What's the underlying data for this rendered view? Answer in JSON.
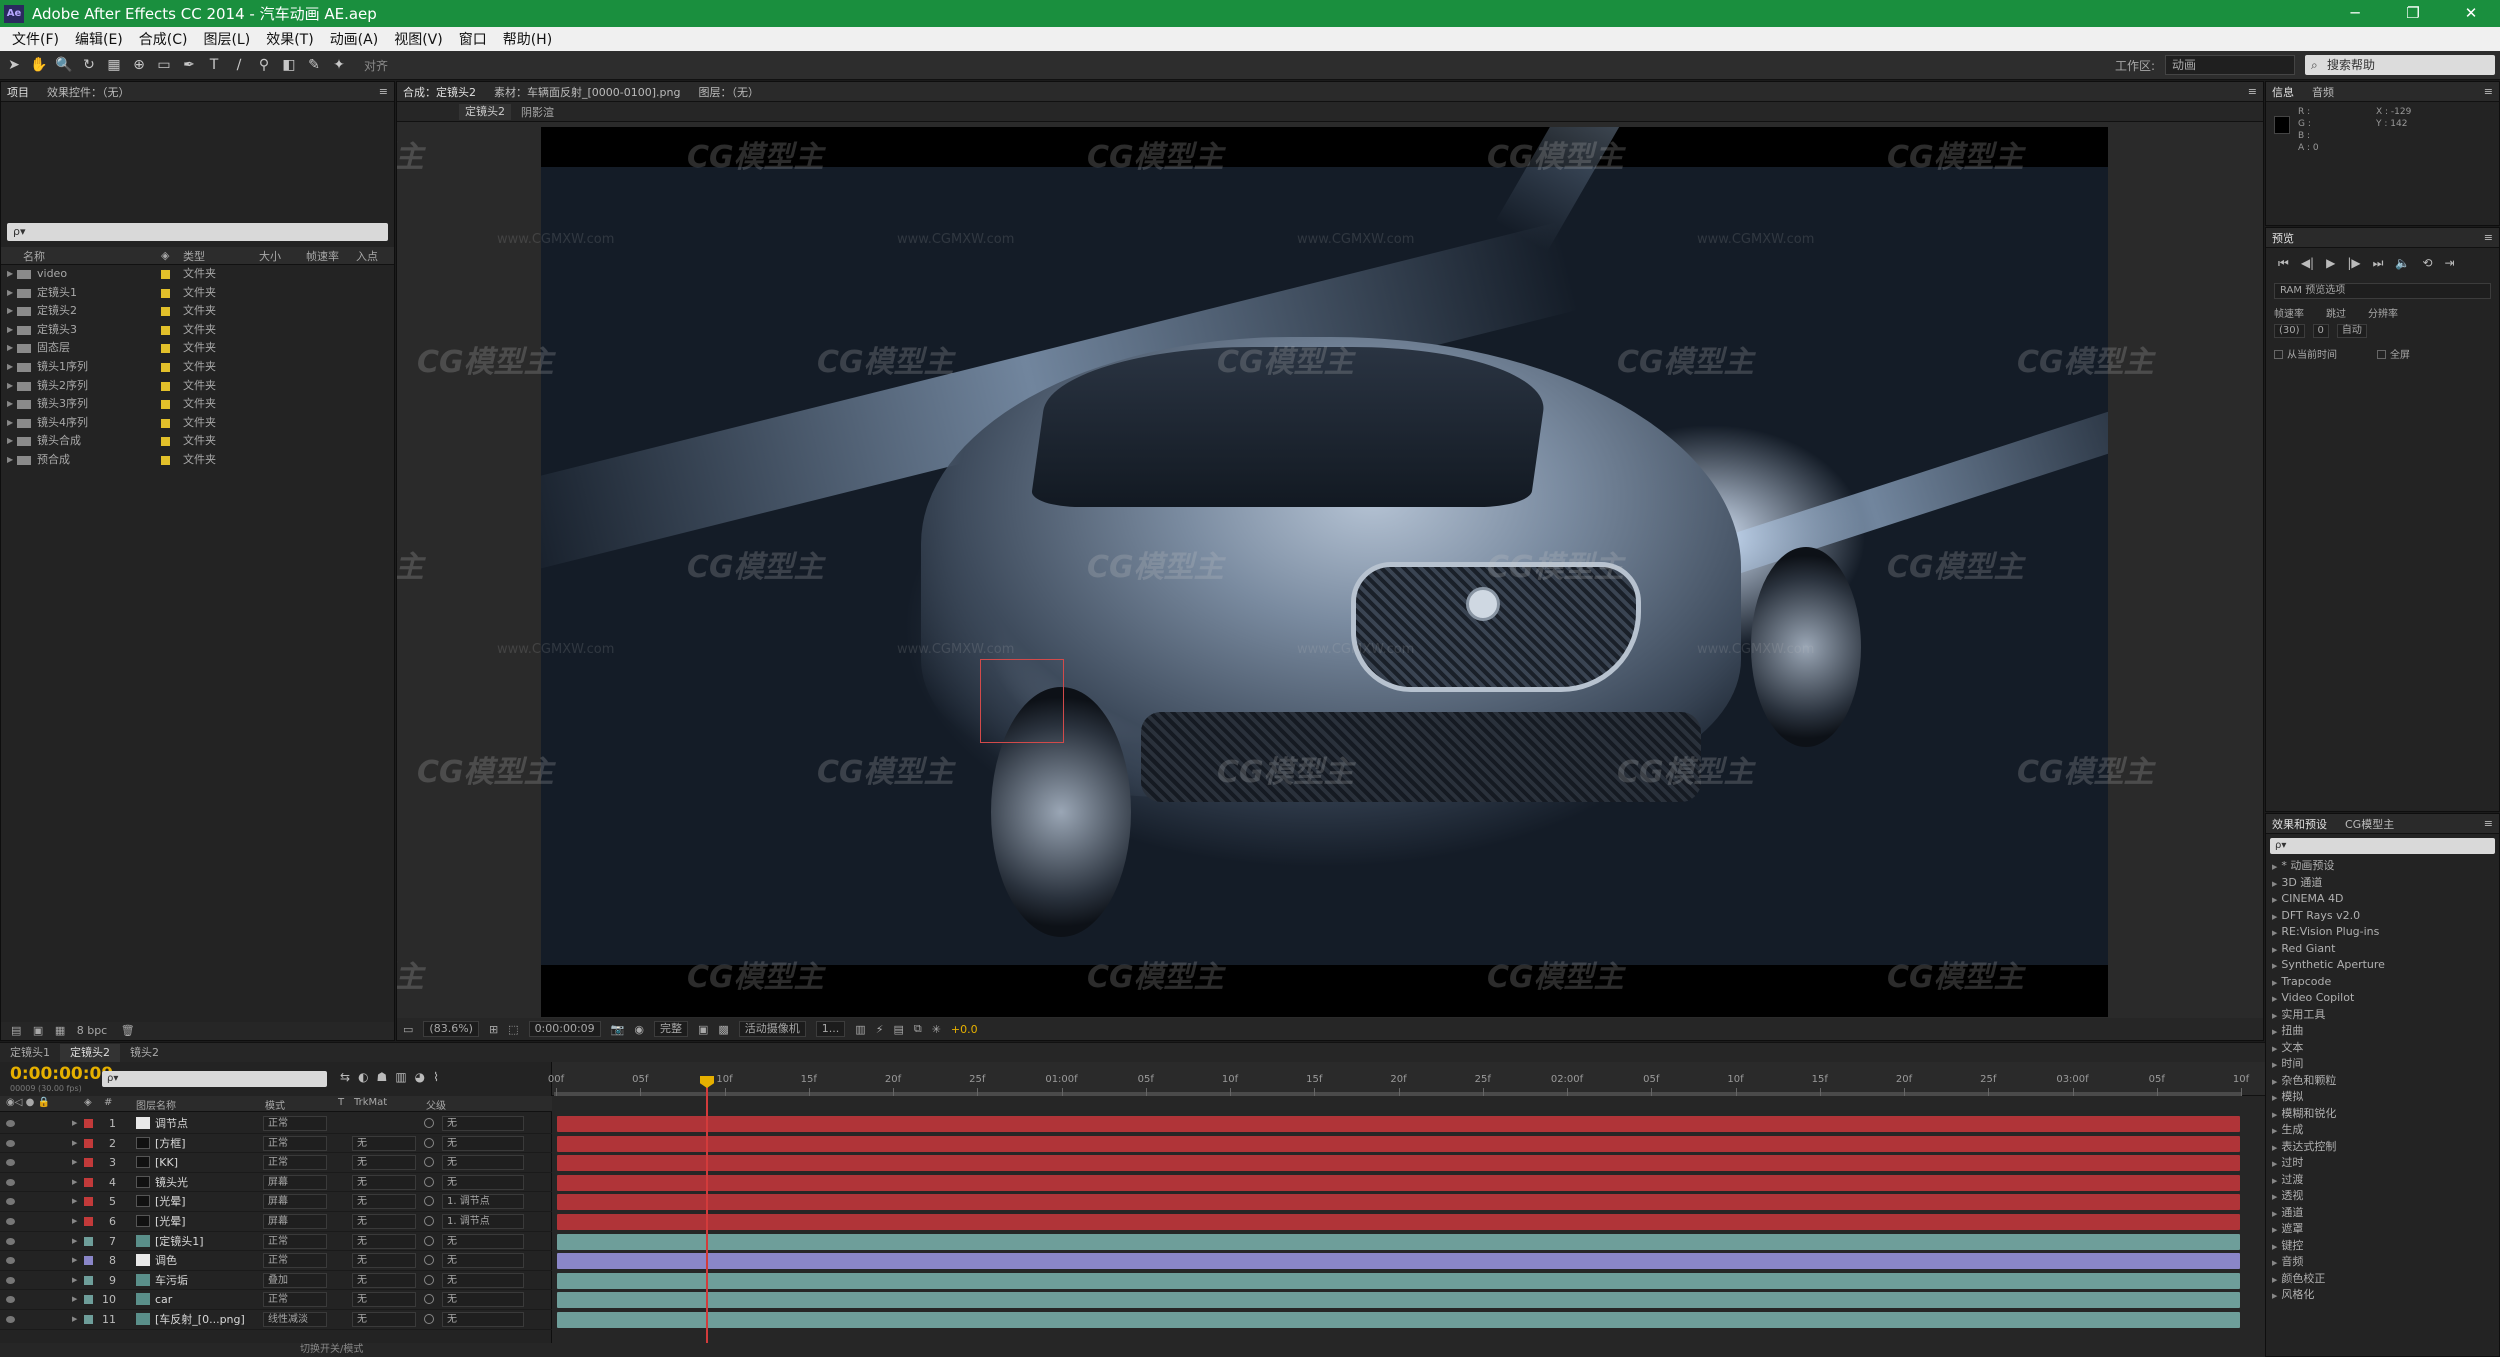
{
  "window": {
    "title": "Adobe After Effects CC 2014 - 汽车动画 AE.aep",
    "app_icon": "Ae",
    "controls": [
      "─",
      "❐",
      "✕"
    ]
  },
  "menu": [
    "文件(F)",
    "编辑(E)",
    "合成(C)",
    "图层(L)",
    "效果(T)",
    "动画(A)",
    "视图(V)",
    "窗口",
    "帮助(H)"
  ],
  "toolbar": {
    "snap_label": "对齐",
    "workspace_label": "工作区:",
    "workspace_value": "动画",
    "search_placeholder": "搜索帮助"
  },
  "project_panel": {
    "tabs": [
      "项目",
      "效果控件：（无）"
    ],
    "search_placeholder": "ρ▾",
    "columns": {
      "name": "名称",
      "type": "类型",
      "size": "大小",
      "fps": "帧速率",
      "in": "入点"
    },
    "items": [
      {
        "name": "video",
        "type": "文件夹"
      },
      {
        "name": "定镜头1",
        "type": "文件夹"
      },
      {
        "name": "定镜头2",
        "type": "文件夹"
      },
      {
        "name": "定镜头3",
        "type": "文件夹"
      },
      {
        "name": "固态层",
        "type": "文件夹"
      },
      {
        "name": "镜头1序列",
        "type": "文件夹"
      },
      {
        "name": "镜头2序列",
        "type": "文件夹"
      },
      {
        "name": "镜头3序列",
        "type": "文件夹"
      },
      {
        "name": "镜头4序列",
        "type": "文件夹"
      },
      {
        "name": "镜头合成",
        "type": "文件夹"
      },
      {
        "name": "预合成",
        "type": "文件夹"
      }
    ],
    "footer_bpc": "8 bpc"
  },
  "composition_panel": {
    "tabs": [
      "合成：定镜头2",
      "素材：车辆面反射_[0000-0100].png",
      "图层：（无）"
    ],
    "breadcrumb": [
      "定镜头2",
      "阴影渲"
    ],
    "zoom": "(83.6%)",
    "timecode": "0:00:00:09",
    "resolution": "完整",
    "camera": "活动摄像机",
    "views": "1...",
    "exposure": "+0.0"
  },
  "info_panel": {
    "tabs": [
      "信息",
      "音频"
    ],
    "rgba": [
      "R :",
      "G :",
      "B :",
      "A : 0"
    ],
    "xy": [
      "X : -129",
      "Y : 142"
    ]
  },
  "preview_panel": {
    "tab": "预览",
    "buttons": [
      "⏮",
      "◀|",
      "▶",
      "|▶",
      "⏭",
      "🔈",
      "⟲",
      "⇥"
    ],
    "ram_options": "RAM 预览选项",
    "labels": [
      "帧速率",
      "跳过",
      "分辨率"
    ],
    "fps_value": "(30)",
    "skip_value": "0",
    "resolution_value": "自动",
    "from_current": "从当前时间",
    "fullscreen": "全屏"
  },
  "effects_panel": {
    "tabs": [
      "效果和预设",
      "CG模型主"
    ],
    "search_placeholder": "ρ▾",
    "items": [
      "* 动画预设",
      "3D 通道",
      "CINEMA 4D",
      "DFT Rays v2.0",
      "RE:Vision Plug-ins",
      "Red Giant",
      "Synthetic Aperture",
      "Trapcode",
      "Video Copilot",
      "实用工具",
      "扭曲",
      "文本",
      "时间",
      "杂色和颗粒",
      "模拟",
      "模糊和锐化",
      "生成",
      "表达式控制",
      "过时",
      "过渡",
      "透视",
      "通道",
      "遮罩",
      "键控",
      "音频",
      "颜色校正",
      "风格化"
    ]
  },
  "timeline": {
    "tabs": [
      "定镜头1",
      "定镜头2",
      "镜头2"
    ],
    "timecode": "0:00:00:09",
    "fps_label": "00009 (30.00 fps)",
    "search_placeholder": "ρ▾",
    "columns": {
      "name": "图层名称",
      "mode": "模式",
      "t": "T",
      "trkmat": "TrkMat",
      "parent": "父级"
    },
    "layers": [
      {
        "num": "1",
        "name": "调节点",
        "mode": "正常",
        "trk": "",
        "parent": "无",
        "color": "#c23a3a",
        "thumb": "white"
      },
      {
        "num": "2",
        "name": "[方框]",
        "mode": "正常",
        "trk": "无",
        "parent": "无",
        "color": "#c23a3a",
        "thumb": "dark"
      },
      {
        "num": "3",
        "name": "[KK]",
        "mode": "正常",
        "trk": "无",
        "parent": "无",
        "color": "#c23a3a",
        "thumb": "dark"
      },
      {
        "num": "4",
        "name": "镜头光",
        "mode": "屏幕",
        "trk": "无",
        "parent": "无",
        "color": "#c23a3a",
        "thumb": "dark"
      },
      {
        "num": "5",
        "name": "[光晕]",
        "mode": "屏幕",
        "trk": "无",
        "parent": "1. 调节点",
        "color": "#c23a3a",
        "thumb": "dark"
      },
      {
        "num": "6",
        "name": "[光晕]",
        "mode": "屏幕",
        "trk": "无",
        "parent": "1. 调节点",
        "color": "#c23a3a",
        "thumb": "dark"
      },
      {
        "num": "7",
        "name": "[定镜头1]",
        "mode": "正常",
        "trk": "无",
        "parent": "无",
        "color": "#6e9e9a",
        "thumb": "img"
      },
      {
        "num": "8",
        "name": "调色",
        "mode": "正常",
        "trk": "无",
        "parent": "无",
        "color": "#8a86c8",
        "thumb": "white"
      },
      {
        "num": "9",
        "name": "车污垢",
        "mode": "叠加",
        "trk": "无",
        "parent": "无",
        "color": "#6e9e9a",
        "thumb": "img"
      },
      {
        "num": "10",
        "name": "car",
        "mode": "正常",
        "trk": "无",
        "parent": "无",
        "color": "#6e9e9a",
        "thumb": "img"
      },
      {
        "num": "11",
        "name": "[车反射_[0...png]",
        "mode": "线性减淡",
        "trk": "无",
        "parent": "无",
        "color": "#6e9e9a",
        "thumb": "img"
      }
    ],
    "ruler_labels": [
      "00f",
      "05f",
      "10f",
      "15f",
      "20f",
      "25f",
      "01:00f",
      "05f",
      "10f",
      "15f",
      "20f",
      "25f",
      "02:00f",
      "05f",
      "10f",
      "15f",
      "20f",
      "25f",
      "03:00f",
      "05f",
      "10f"
    ],
    "bottom_label": "切换开关/模式"
  },
  "watermark": {
    "brand": "CG模型主",
    "url": "www.CGMXW.com"
  }
}
